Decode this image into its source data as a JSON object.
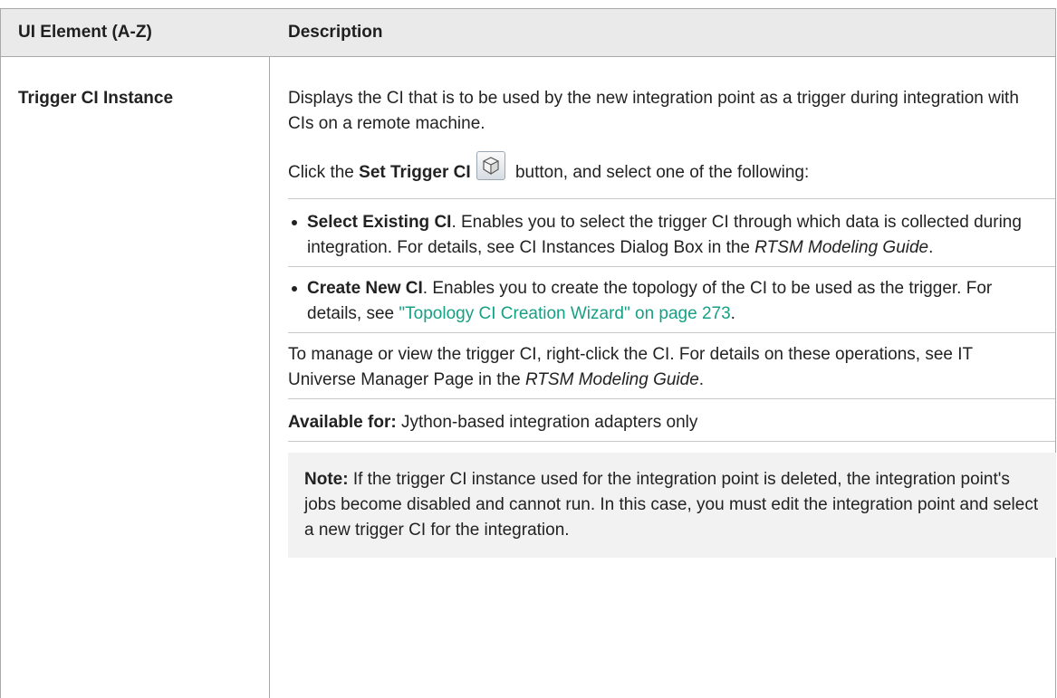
{
  "table": {
    "col1_header": "UI Element (A-Z)",
    "col2_header": "Description"
  },
  "row": {
    "label": "Trigger CI Instance",
    "intro": "Displays the CI that is to be used by the new integration point as a trigger during integration with CIs on a remote machine.",
    "click_prefix": "Click the ",
    "click_bold": "Set Trigger CI",
    "click_suffix": " button, and select one of the following:",
    "options": [
      {
        "title": "Select Existing CI",
        "text_before_italic": ". Enables you to select the trigger CI through which data is collected during integration. For details, see CI Instances Dialog Box in the ",
        "italic": "RTSM Modeling Guide",
        "text_after_italic": "."
      },
      {
        "title": "Create New CI",
        "text_before_link": ". Enables you to create the topology of the CI to be used as the trigger. For details, see ",
        "link": "\"Topology CI Creation Wizard\" on page 273",
        "text_after_link": "."
      }
    ],
    "manage_before_italic": "To manage or view the trigger CI, right-click the CI. For details on these operations, see IT Universe Manager Page in the ",
    "manage_italic": "RTSM Modeling Guide",
    "manage_after_italic": ".",
    "available_label": "Available for:",
    "available_text": " Jython-based integration adapters only",
    "note_label": "Note:",
    "note_text": " If the trigger CI instance used for the integration point is deleted, the integration point's jobs become disabled and cannot run. In this case, you must edit the integration point and select a new trigger CI for the integration."
  },
  "icons": {
    "set_trigger_ci_button": "cube-icon"
  }
}
